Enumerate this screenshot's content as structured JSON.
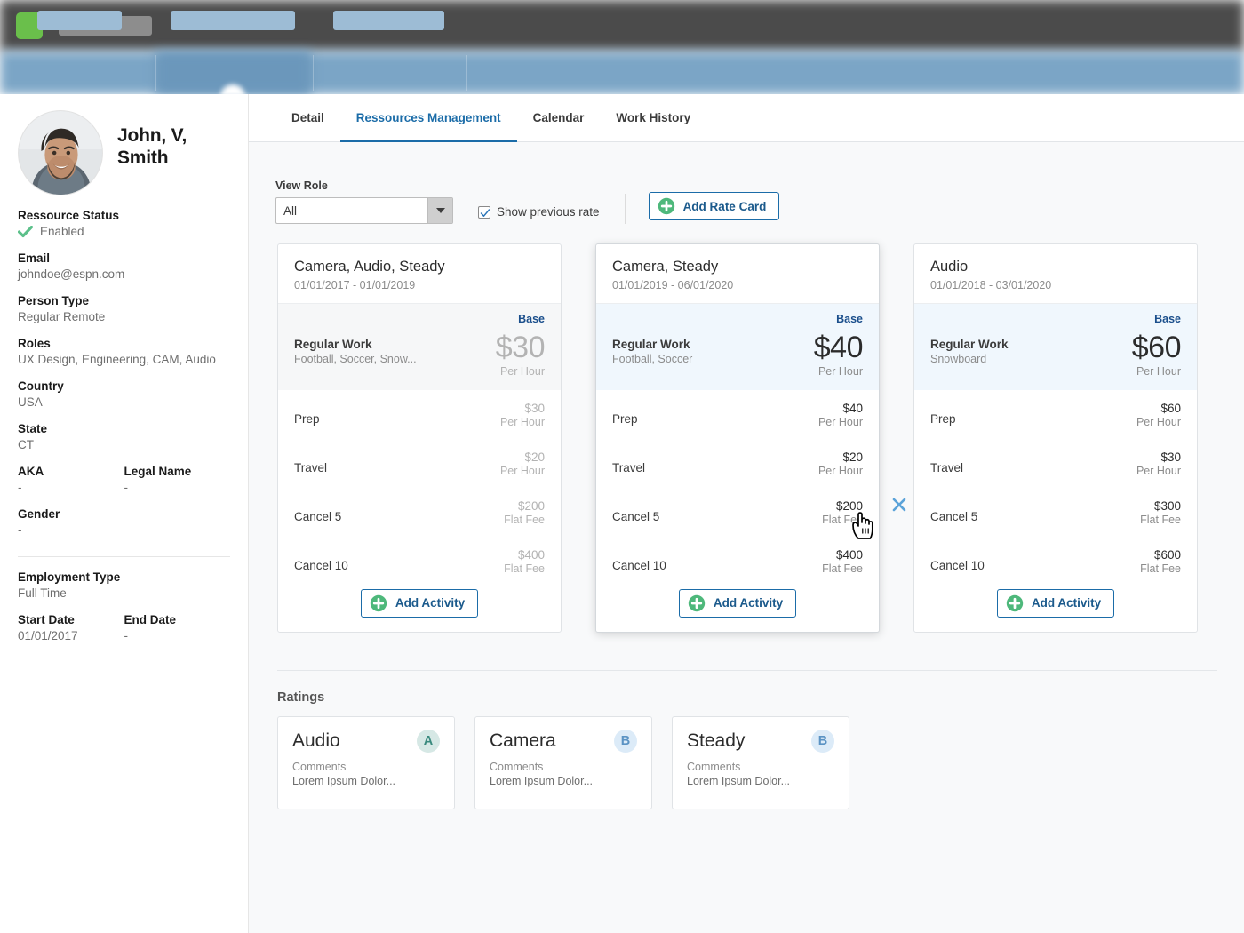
{
  "topbar": {
    "brand": "",
    "logo_color": "#6abf4b",
    "bar_color": "#4b4b4b",
    "subbar_color": "#7ba5c6"
  },
  "sidebar": {
    "person_name": "John, V, Smith",
    "avatar_icon": "user-photo-avatar",
    "fields": [
      {
        "label": "Ressource Status",
        "value": "Enabled",
        "icon": "green-check-icon"
      },
      {
        "label": "Email",
        "value": "johndoe@espn.com"
      },
      {
        "label": "Person Type",
        "value": "Regular Remote"
      },
      {
        "label": "Roles",
        "value": "UX Design, Engineering, CAM, Audio"
      },
      {
        "label": "Country",
        "value": "USA"
      },
      {
        "label": "State",
        "value": "CT"
      }
    ],
    "aka": {
      "label": "AKA",
      "value": "-"
    },
    "legal_name": {
      "label": "Legal Name",
      "value": "-"
    },
    "gender": {
      "label": "Gender",
      "value": "-"
    },
    "employment_type": {
      "label": "Employment Type",
      "value": "Full Time"
    },
    "start_date": {
      "label": "Start Date",
      "value": "01/01/2017"
    },
    "end_date": {
      "label": "End Date",
      "value": "-"
    }
  },
  "tabs": [
    {
      "label": "Detail",
      "active": false
    },
    {
      "label": "Ressources Management",
      "active": true
    },
    {
      "label": "Calendar",
      "active": false
    },
    {
      "label": "Work History",
      "active": false
    }
  ],
  "toolbar": {
    "view_role_label": "View Role",
    "view_role_value": "All",
    "show_previous_rate_label": "Show previous rate",
    "show_previous_rate_checked": true,
    "add_rate_card_label": "Add Rate Card",
    "accent_blue": "#1b6ca8",
    "accent_green": "#4eb87b"
  },
  "rate_cards": [
    {
      "title": "Camera, Audio, Steady",
      "dates": "01/01/2017 - 01/01/2019",
      "style": "previous",
      "base_label": "Base",
      "base_title": "Regular Work",
      "base_sub": "Football, Soccer, Snow...",
      "base_amount": "$30",
      "base_unit": "Per Hour",
      "activities": [
        {
          "name": "Prep",
          "amount": "$30",
          "unit": "Per Hour"
        },
        {
          "name": "Travel",
          "amount": "$20",
          "unit": "Per Hour"
        },
        {
          "name": "Cancel 5",
          "amount": "$200",
          "unit": "Flat Fee"
        },
        {
          "name": "Cancel 10",
          "amount": "$400",
          "unit": "Flat Fee"
        }
      ],
      "add_activity_label": "Add Activity"
    },
    {
      "title": "Camera, Steady",
      "dates": "01/01/2019 - 06/01/2020",
      "style": "current",
      "hovered": true,
      "base_label": "Base",
      "base_title": "Regular Work",
      "base_sub": "Football, Soccer",
      "base_amount": "$40",
      "base_unit": "Per Hour",
      "activities": [
        {
          "name": "Prep",
          "amount": "$40",
          "unit": "Per Hour"
        },
        {
          "name": "Travel",
          "amount": "$20",
          "unit": "Per Hour"
        },
        {
          "name": "Cancel 5",
          "amount": "$200",
          "unit": "Flat Fee",
          "delete_icon": "close-x-icon"
        },
        {
          "name": "Cancel 10",
          "amount": "$400",
          "unit": "Flat Fee"
        }
      ],
      "add_activity_label": "Add Activity"
    },
    {
      "title": "Audio",
      "dates": "01/01/2018 - 03/01/2020",
      "style": "current",
      "base_label": "Base",
      "base_title": "Regular Work",
      "base_sub": "Snowboard",
      "base_amount": "$60",
      "base_unit": "Per Hour",
      "activities": [
        {
          "name": "Prep",
          "amount": "$60",
          "unit": "Per Hour"
        },
        {
          "name": "Travel",
          "amount": "$30",
          "unit": "Per Hour"
        },
        {
          "name": "Cancel 5",
          "amount": "$300",
          "unit": "Flat Fee"
        },
        {
          "name": "Cancel 10",
          "amount": "$600",
          "unit": "Flat Fee"
        }
      ],
      "add_activity_label": "Add Activity"
    }
  ],
  "ratings": {
    "title": "Ratings",
    "items": [
      {
        "name": "Audio",
        "grade": "A",
        "grade_bg": "#d6e8e5",
        "grade_fg": "#3a8a7e",
        "comments_label": "Comments",
        "comment": "Lorem Ipsum Dolor..."
      },
      {
        "name": "Camera",
        "grade": "B",
        "grade_bg": "#dcebf8",
        "grade_fg": "#5b93c4",
        "comments_label": "Comments",
        "comment": "Lorem Ipsum Dolor..."
      },
      {
        "name": "Steady",
        "grade": "B",
        "grade_bg": "#dcebf8",
        "grade_fg": "#5b93c4",
        "comments_label": "Comments",
        "comment": "Lorem Ipsum Dolor..."
      }
    ]
  },
  "cursor": {
    "icon": "pointing-hand-cursor"
  }
}
